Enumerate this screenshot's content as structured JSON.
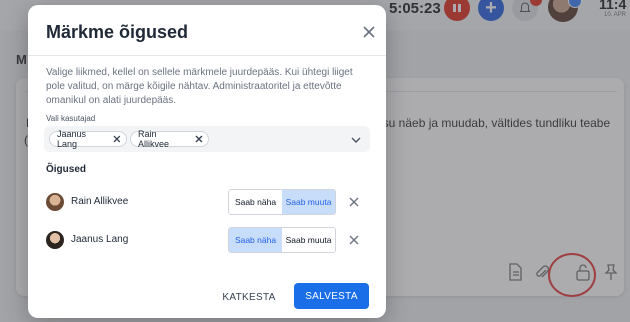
{
  "background": {
    "time": "5:05:23",
    "clock": "11:4",
    "date": "10. APR",
    "heading": "M",
    "card_text_fragment": "K",
    "card_text_fragment2": "(",
    "card_trail_text": "sisu näeb ja muudab, vältides tundliku teabe",
    "notification_count": "",
    "accent_red": "#e0301e",
    "accent_blue": "#2b5fe0"
  },
  "dialog": {
    "title": "Märkme õigused",
    "description": "Valige liikmed, kellel on sellele märkmele juurdepääs. Kui ühtegi liiget pole valitud, on märge kõigile nähtav. Administraatoritel ja ettevõtte omanikul on alati juurdepääs.",
    "select_label": "Vali kasutajad",
    "selected_users": [
      "Jaanus Lang",
      "Rain Allikvee"
    ],
    "permissions_heading": "Õigused",
    "permissions": [
      {
        "name": "Rain Allikvee",
        "view_label": "Saab näha",
        "edit_label": "Saab muuta",
        "selected": "edit"
      },
      {
        "name": "Jaanus Lang",
        "view_label": "Saab näha",
        "edit_label": "Saab muuta",
        "selected": "view"
      }
    ],
    "cancel_label": "KATKESTA",
    "save_label": "SALVESTA",
    "primary_color": "#1a6fe8"
  }
}
